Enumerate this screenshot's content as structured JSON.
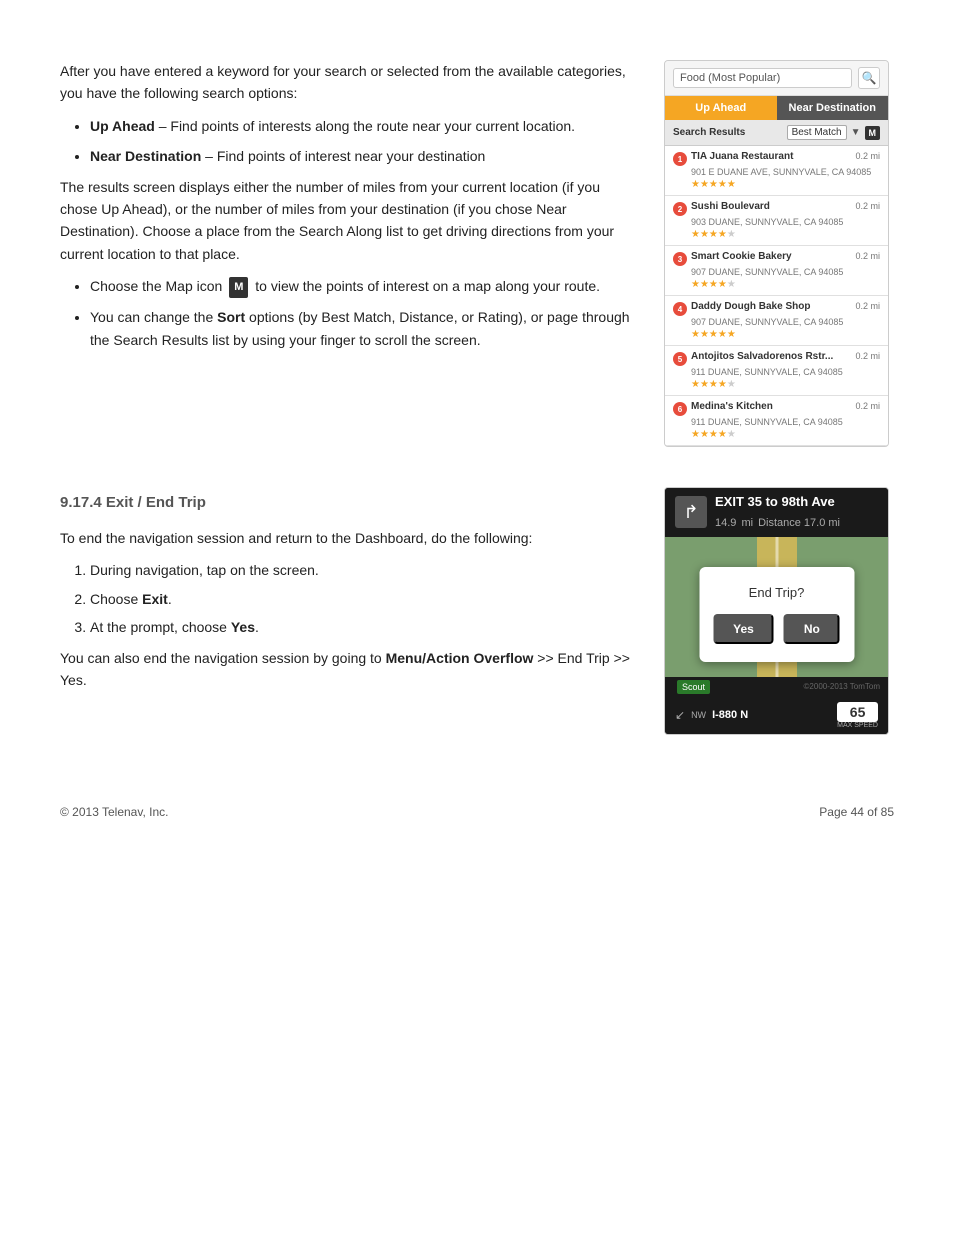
{
  "page": {
    "copyright": "© 2013 Telenav, Inc.",
    "page_num": "Page 44 of 85"
  },
  "intro_paragraph": "After you have entered a keyword for your search or selected from the available categories, you have the following search options:",
  "bullet1_bold": "Up Ahead",
  "bullet1_text": " – Find points of interests along the route near your current location.",
  "bullet2_bold": "Near Destination",
  "bullet2_text": " – Find points of interest near your destination",
  "results_paragraph": "The results screen displays either the number of miles from your current location (if you chose Up Ahead), or the number of miles from your destination (if you chose Near Destination). Choose a place from the Search Along list to get driving directions from your current location to that place.",
  "bullet3_text": " to view the points of interest on a map along your route.",
  "bullet3_prefix": "Choose the Map icon",
  "bullet4_prefix": "You can change the ",
  "bullet4_bold": "Sort",
  "bullet4_text": " options (by Best Match, Distance, or Rating), or page through the Search Results list by using your finger to scroll the screen.",
  "section_title": "9.17.4 Exit / End Trip",
  "section_para1": "To end the navigation session and return to the Dashboard, do the following:",
  "step1": "During navigation, tap on the screen.",
  "step2": "Choose ",
  "step2_bold": "Exit",
  "step2_end": ".",
  "step3": "At the prompt, choose ",
  "step3_bold": "Yes",
  "step3_end": ".",
  "section_para2_prefix": "You can also end the navigation session by going to ",
  "section_para2_bold": "Menu/Action Overflow",
  "section_para2_text": " >> End Trip >> Yes.",
  "search_screenshot": {
    "search_placeholder": "Food (Most Popular)",
    "tab_up_ahead": "Up Ahead",
    "tab_near_dest": "Near Destination",
    "results_label": "Search Results",
    "sort_label": "Best Match",
    "map_icon_label": "M",
    "results": [
      {
        "num": "1",
        "name": "TIA Juana Restaurant",
        "addr": "901 E DUANE AVE, SUNNYVALE, CA 94085",
        "dist": "0.2 mi",
        "stars": 5
      },
      {
        "num": "2",
        "name": "Sushi Boulevard",
        "addr": "903 DUANE, SUNNYVALE, CA 94085",
        "dist": "0.2 mi",
        "stars": 4
      },
      {
        "num": "3",
        "name": "Smart Cookie Bakery",
        "addr": "907 DUANE, SUNNYVALE, CA 94085",
        "dist": "0.2 mi",
        "stars": 4
      },
      {
        "num": "4",
        "name": "Daddy Dough Bake Shop",
        "addr": "907 DUANE, SUNNYVALE, CA 94085",
        "dist": "0.2 mi",
        "stars": 5
      },
      {
        "num": "5",
        "name": "Antojitos Salvadorenos Rstr...",
        "addr": "911 DUANE, SUNNYVALE, CA 94085",
        "dist": "0.2 mi",
        "stars": 4
      },
      {
        "num": "6",
        "name": "Medina's Kitchen",
        "addr": "911 DUANE, SUNNYVALE, CA 94085",
        "dist": "0.2 mi",
        "stars": 4
      }
    ]
  },
  "nav_screenshot": {
    "exit_text": "EXIT 35 to 98th Ave",
    "miles": "14.9",
    "miles_unit": "mi",
    "distance_label": "Distance",
    "distance_val": "17.0",
    "distance_unit": "mi",
    "end_trip_label": "End Trip?",
    "yes_label": "Yes",
    "no_label": "No",
    "direction": "NW",
    "road_name": "I-880 N",
    "speed": "65",
    "speed_label": "MAX SPEED",
    "scout_label": "Scout",
    "copyright_map": "©2000-2013 TomTom"
  }
}
